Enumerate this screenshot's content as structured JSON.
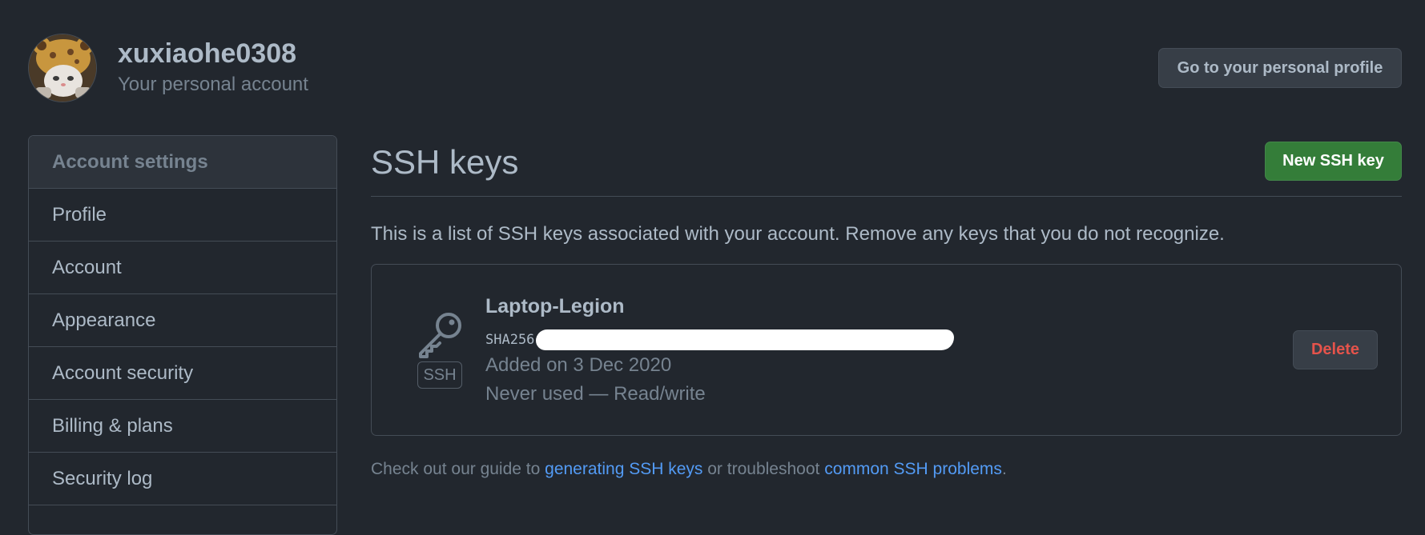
{
  "header": {
    "username": "xuxiaohe0308",
    "subtitle": "Your personal account",
    "profile_button": "Go to your personal profile"
  },
  "sidebar": {
    "heading": "Account settings",
    "items": [
      {
        "label": "Profile"
      },
      {
        "label": "Account"
      },
      {
        "label": "Appearance"
      },
      {
        "label": "Account security"
      },
      {
        "label": "Billing & plans"
      },
      {
        "label": "Security log"
      }
    ]
  },
  "main": {
    "title": "SSH keys",
    "new_key_button": "New SSH key",
    "intro": "This is a list of SSH keys associated with your account. Remove any keys that you do not recognize.",
    "key": {
      "title": "Laptop-Legion",
      "badge": "SSH",
      "fingerprint_prefix": "SHA256",
      "added": "Added on 3 Dec 2020",
      "usage": "Never used — Read/write",
      "delete_button": "Delete",
      "icon": "key-icon"
    },
    "footer": {
      "text_before": "Check out our guide to ",
      "link1": "generating SSH keys",
      "text_middle": " or troubleshoot ",
      "link2": "common SSH problems",
      "text_after": "."
    }
  },
  "colors": {
    "background": "#22272e",
    "border": "#444c56",
    "primary_button": "#347d39",
    "danger_text": "#e5534b",
    "link": "#539bf5"
  }
}
